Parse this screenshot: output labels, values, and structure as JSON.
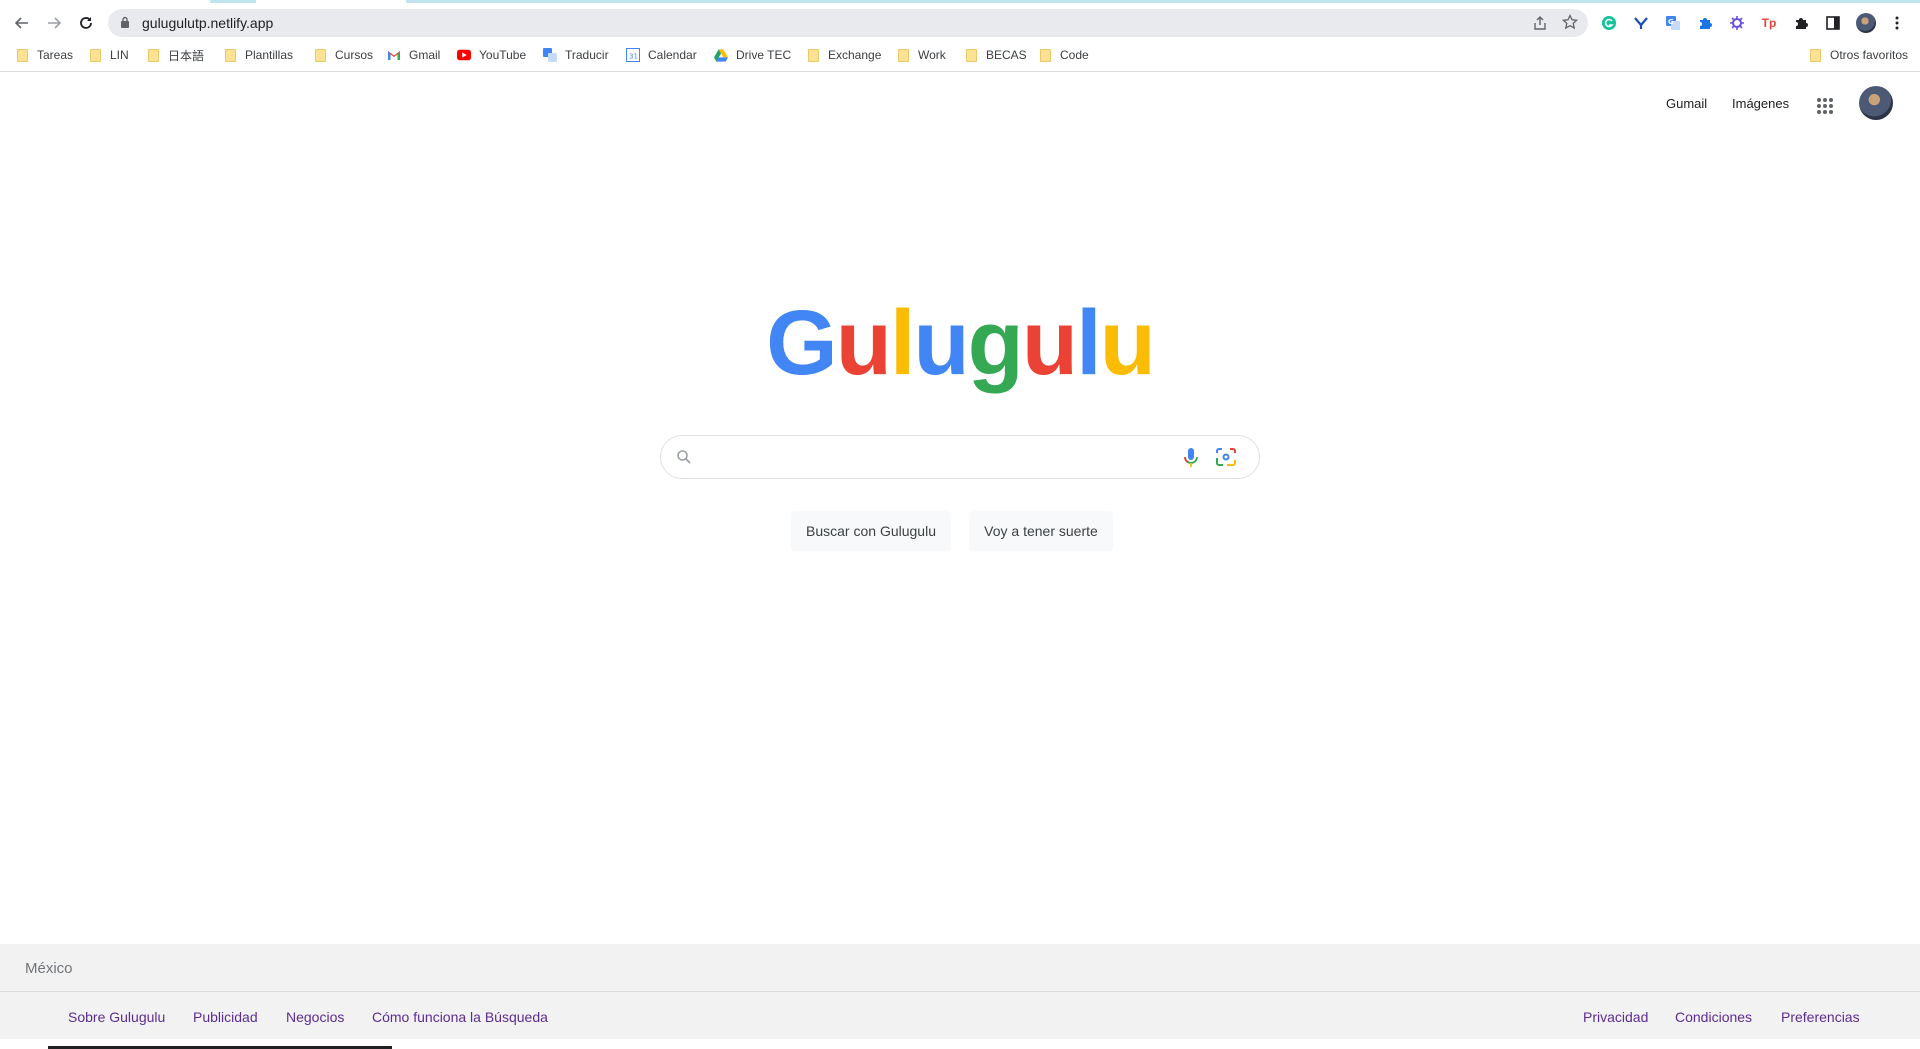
{
  "browser": {
    "url": "gulugulutp.netlify.app",
    "bookmarks": [
      {
        "label": "Tareas",
        "icon": "folder-icon"
      },
      {
        "label": "LIN",
        "icon": "folder-icon"
      },
      {
        "label": "日本語",
        "icon": "folder-icon"
      },
      {
        "label": "Plantillas",
        "icon": "folder-icon"
      },
      {
        "label": "Cursos",
        "icon": "folder-icon"
      },
      {
        "label": "Gmail",
        "icon": "gmail-icon"
      },
      {
        "label": "YouTube",
        "icon": "youtube-icon"
      },
      {
        "label": "Traducir",
        "icon": "translate-icon"
      },
      {
        "label": "Calendar",
        "icon": "calendar-icon"
      },
      {
        "label": "Drive TEC",
        "icon": "drive-icon"
      },
      {
        "label": "Exchange",
        "icon": "folder-icon"
      },
      {
        "label": "Work",
        "icon": "folder-icon"
      },
      {
        "label": "BECAS",
        "icon": "folder-icon"
      },
      {
        "label": "Code",
        "icon": "folder-icon"
      }
    ],
    "other_bookmarks": "Otros favoritos",
    "extensions": [
      "grammarly-icon",
      "y-extension-icon",
      "translate-extension-icon",
      "puzzle-blue-icon",
      "gear-purple-icon",
      "tp-extension-icon",
      "extensions-icon",
      "sidepanel-icon",
      "profile-avatar-icon",
      "more-vert-icon"
    ]
  },
  "header": {
    "gmail_link": "Gumail",
    "images_link": "Imágenes"
  },
  "logo": {
    "letters": [
      "G",
      "u",
      "l",
      "u",
      "g",
      "u",
      "l",
      "u"
    ],
    "colors": [
      "#4285f4",
      "#ea4335",
      "#fbbc05",
      "#4285f4",
      "#34a853",
      "#ea4335",
      "#4285f4",
      "#fbbc05"
    ]
  },
  "search": {
    "value": "",
    "placeholder": ""
  },
  "buttons": {
    "search": "Buscar con Gulugulu",
    "lucky": "Voy a tener suerte"
  },
  "footer": {
    "country": "México",
    "left_links": [
      "Sobre Gulugulu",
      "Publicidad",
      "Negocios",
      "Cómo funciona la Búsqueda"
    ],
    "right_links": [
      "Privacidad",
      "Condiciones",
      "Preferencias"
    ]
  }
}
